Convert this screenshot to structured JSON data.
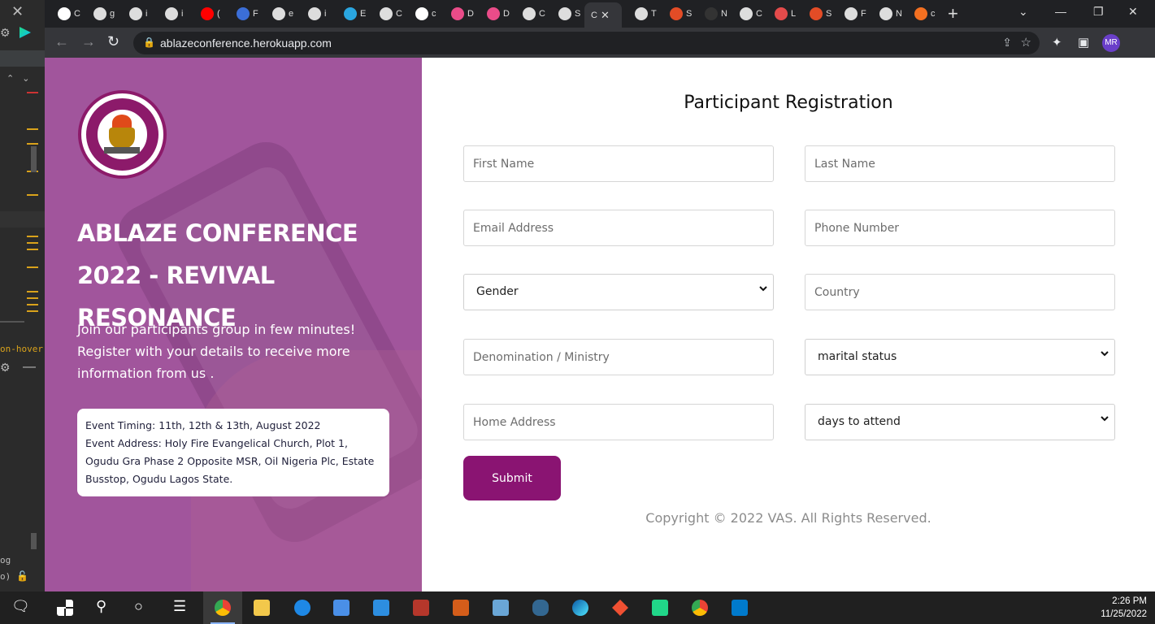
{
  "browser": {
    "url": "ablazeconference.herokuapp.com",
    "active_tab_label": "C",
    "tabs": [
      {
        "label": "C",
        "icon": "google-icon",
        "color": "#ffffff"
      },
      {
        "label": "g",
        "icon": "globe-icon",
        "color": "#dddddd"
      },
      {
        "label": "i",
        "icon": "globe-icon",
        "color": "#dddddd"
      },
      {
        "label": "i",
        "icon": "globe-icon",
        "color": "#dddddd"
      },
      {
        "label": "(",
        "icon": "youtube-icon",
        "color": "#ff0000"
      },
      {
        "label": "F",
        "icon": "video-icon",
        "color": "#3b6ed8"
      },
      {
        "label": "e",
        "icon": "globe-icon",
        "color": "#dddddd"
      },
      {
        "label": "i",
        "icon": "globe-icon",
        "color": "#dddddd"
      },
      {
        "label": "E",
        "icon": "flower-icon",
        "color": "#2aa6e0"
      },
      {
        "label": "C",
        "icon": "globe-icon",
        "color": "#dddddd"
      },
      {
        "label": "c",
        "icon": "google-icon",
        "color": "#ffffff"
      },
      {
        "label": "D",
        "icon": "dribbble-icon",
        "color": "#ea4c89"
      },
      {
        "label": "D",
        "icon": "dribbble-icon",
        "color": "#ea4c89"
      },
      {
        "label": "C",
        "icon": "globe-icon",
        "color": "#dddddd"
      },
      {
        "label": "S",
        "icon": "globe-icon",
        "color": "#dddddd"
      }
    ],
    "tabs_right": [
      {
        "label": "T",
        "icon": "cube-icon",
        "color": "#dddddd"
      },
      {
        "label": "S",
        "icon": "s-icon",
        "color": "#e34c26"
      },
      {
        "label": "N",
        "icon": "github-icon",
        "color": "#333333"
      },
      {
        "label": "C",
        "icon": "globe-icon",
        "color": "#dddddd"
      },
      {
        "label": "L",
        "icon": "asterisk-icon",
        "color": "#e44b4b"
      },
      {
        "label": "S",
        "icon": "s-icon",
        "color": "#e34c26"
      },
      {
        "label": "F",
        "icon": "globe-icon",
        "color": "#dddddd"
      },
      {
        "label": "N",
        "icon": "globe-icon",
        "color": "#dddddd"
      },
      {
        "label": "c",
        "icon": "cp-icon",
        "color": "#f37021"
      }
    ],
    "profile_initials": "MR"
  },
  "editor": {
    "hover_text": "on-hover",
    "log_text": "og",
    "o_text": "o)"
  },
  "hero": {
    "title": "ABLAZE CONFERENCE 2022 - REVIVAL RESONANCE",
    "description": "Join our participants group in few minutes! Register with your details to receive more information from us .",
    "event_timing": "Event Timing: 11th, 12th & 13th, August 2022",
    "event_address": "Event Address: Holy Fire Evangelical Church, Plot 1, Ogudu Gra Phase 2 Opposite MSR, Oil Nigeria Plc, Estate Busstop, Ogudu Lagos State.",
    "logo_text": "VESSELS ABLAZE SQUAD INTERNATIONAL MINISTRY",
    "overlay_color": "#a7609f"
  },
  "form": {
    "title": "Participant Registration",
    "first_name_placeholder": "First Name",
    "last_name_placeholder": "Last Name",
    "email_placeholder": "Email Address",
    "phone_placeholder": "Phone Number",
    "gender_selected": "Gender",
    "country_placeholder": "Country",
    "denomination_placeholder": "Denomination / Ministry",
    "marital_selected": "marital status",
    "address_placeholder": "Home Address",
    "days_selected": "days to attend",
    "submit_label": "Submit",
    "submit_color": "#8a1472"
  },
  "footer": {
    "copyright": "Copyright © 2022 VAS. All Rights Reserved."
  },
  "taskbar": {
    "time": "2:26 PM",
    "date": "11/25/2022"
  }
}
